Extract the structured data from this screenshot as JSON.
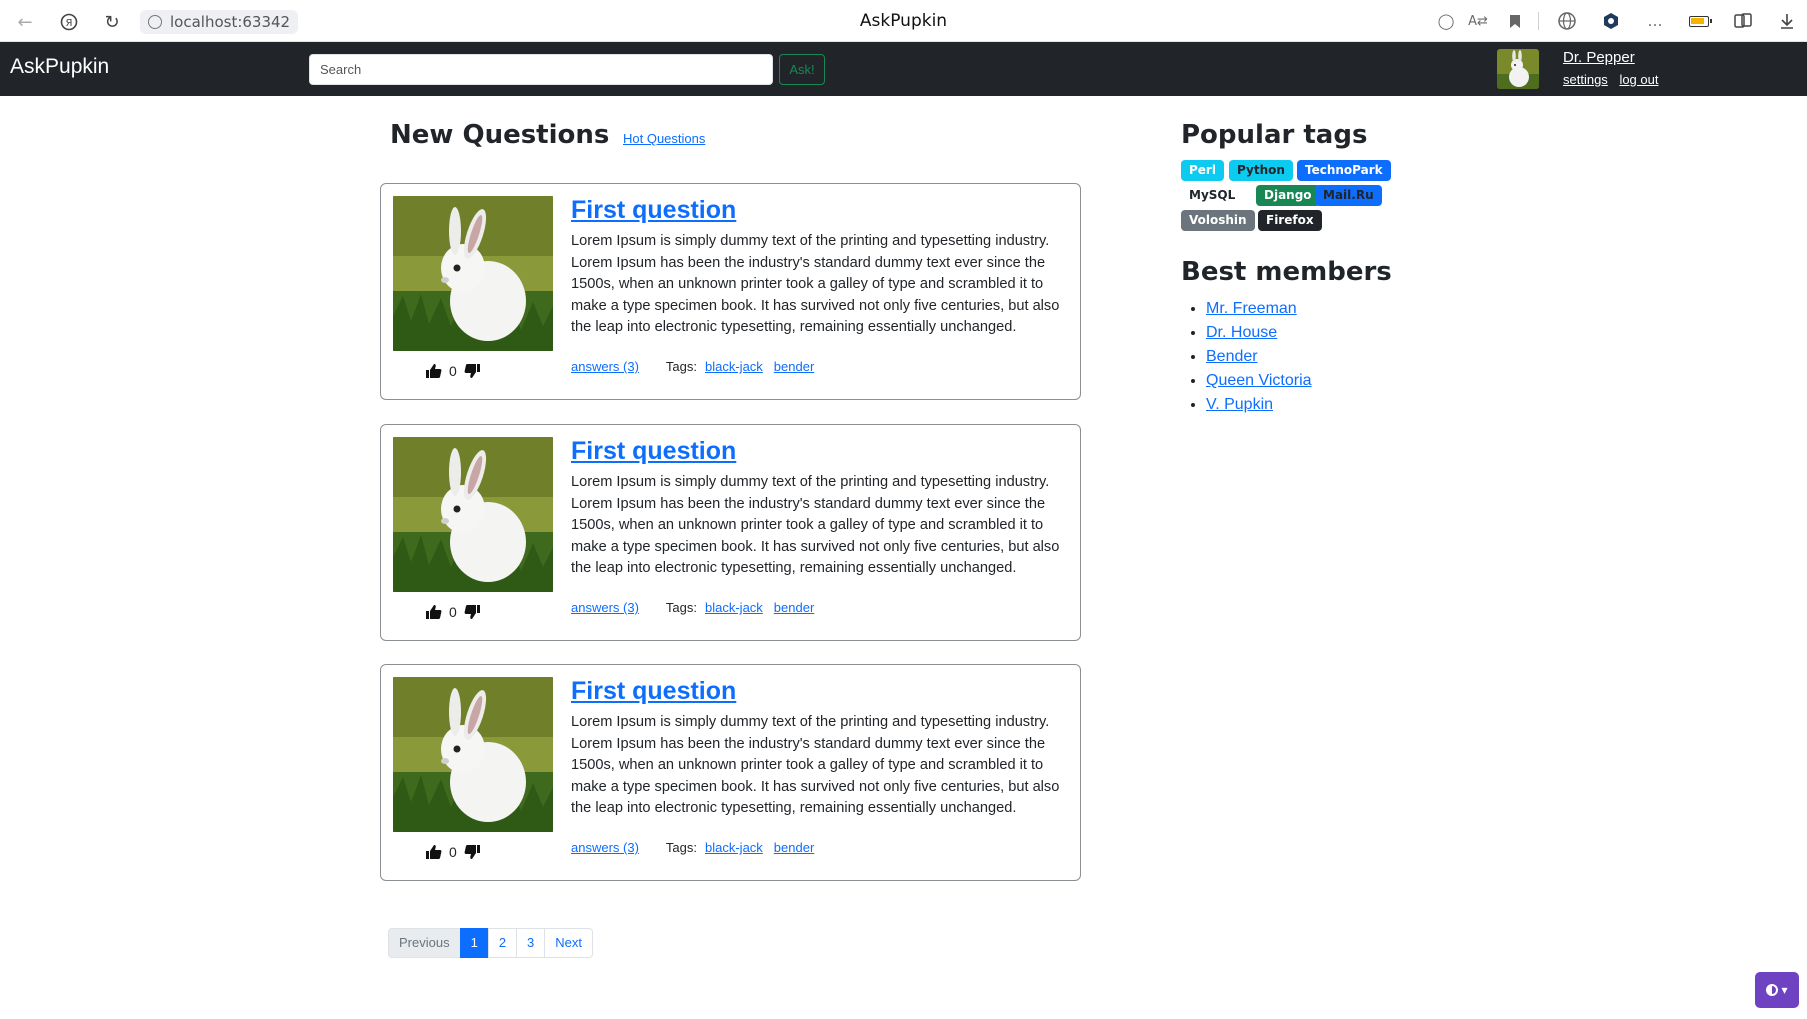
{
  "browser": {
    "url": "localhost:63342",
    "title": "AskPupkin"
  },
  "navbar": {
    "brand": "AskPupkin",
    "search_placeholder": "Search",
    "ask_label": "Ask!",
    "user_name": "Dr. Pepper",
    "settings_label": "settings",
    "logout_label": "log out"
  },
  "main": {
    "title": "New Questions",
    "hot_link": "Hot Questions",
    "questions": [
      {
        "title": "First question",
        "body": "Lorem Ipsum is simply dummy text of the printing and typesetting industry. Lorem Ipsum has been the industry's standard dummy text ever since the 1500s, when an unknown printer took a galley of type and scrambled it to make a type specimen book. It has survived not only five centuries, but also the leap into electronic typesetting, remaining essentially unchanged.",
        "votes": "0",
        "answers": "answers (3)",
        "tags_label": "Tags:",
        "tags": [
          "black-jack",
          "bender"
        ]
      },
      {
        "title": "First question",
        "body": "Lorem Ipsum is simply dummy text of the printing and typesetting industry. Lorem Ipsum has been the industry's standard dummy text ever since the 1500s, when an unknown printer took a galley of type and scrambled it to make a type specimen book. It has survived not only five centuries, but also the leap into electronic typesetting, remaining essentially unchanged.",
        "votes": "0",
        "answers": "answers (3)",
        "tags_label": "Tags:",
        "tags": [
          "black-jack",
          "bender"
        ]
      },
      {
        "title": "First question",
        "body": "Lorem Ipsum is simply dummy text of the printing and typesetting industry. Lorem Ipsum has been the industry's standard dummy text ever since the 1500s, when an unknown printer took a galley of type and scrambled it to make a type specimen book. It has survived not only five centuries, but also the leap into electronic typesetting, remaining essentially unchanged.",
        "votes": "0",
        "answers": "answers (3)",
        "tags_label": "Tags:",
        "tags": [
          "black-jack",
          "bender"
        ]
      }
    ],
    "pagination": {
      "previous": "Previous",
      "pages": [
        "1",
        "2",
        "3"
      ],
      "active_page": "1",
      "next": "Next"
    }
  },
  "sidebar": {
    "tags_title": "Popular tags",
    "tags": [
      {
        "label": "Perl",
        "color": "#0dcaf0",
        "text_color": "#ffffff"
      },
      {
        "label": "Python",
        "color": "#0dcaf0",
        "text_color": "#212529"
      },
      {
        "label": "TechnoPark",
        "color": "#0d6efd",
        "text_color": "#ffffff"
      },
      {
        "label": "MySQL",
        "color": "#ffffff",
        "text_color": "#212529"
      },
      {
        "label": "Django",
        "color": "#198754",
        "text_color": "#ffffff"
      },
      {
        "label": "Mail.Ru",
        "color": "#0d6efd",
        "text_color": "#212529"
      },
      {
        "label": "Voloshin",
        "color": "#6c757d",
        "text_color": "#ffffff"
      },
      {
        "label": "Firefox",
        "color": "#212529",
        "text_color": "#ffffff"
      }
    ],
    "members_title": "Best members",
    "members": [
      "Mr. Freeman",
      "Dr. House",
      "Bender",
      "Queen Victoria",
      "V. Pupkin"
    ]
  },
  "colors": {
    "navbar_bg": "#212529",
    "link": "#0d6efd",
    "ask_button": "#198754",
    "theme_toggle": "#6f42c1"
  },
  "icons": {
    "upvote": "thumbs-up-icon",
    "downvote": "thumbs-down-icon",
    "theme": "contrast-icon"
  }
}
